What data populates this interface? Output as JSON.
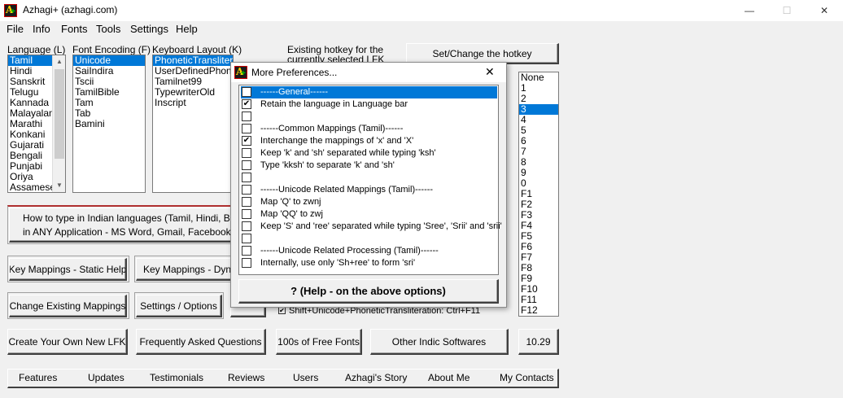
{
  "window": {
    "title": "Azhagi+ (azhagi.com)",
    "min": "—",
    "max": "☐",
    "close": "✕"
  },
  "menu": [
    "File",
    "Info",
    "Fonts",
    "Tools",
    "Settings",
    "Help"
  ],
  "labels": {
    "language": "Language (L)",
    "font_encoding": "Font Encoding (F)",
    "keyboard_layout": "Keyboard Layout (K)",
    "hotkey_info_1": "Existing hotkey for the",
    "hotkey_info_2": "currently selected LFK"
  },
  "languages": [
    "Tamil",
    "Hindi",
    "Sanskrit",
    "Telugu",
    "Kannada",
    "Malayalam",
    "Marathi",
    "Konkani",
    "Gujarati",
    "Bengali",
    "Punjabi",
    "Oriya",
    "Assamese"
  ],
  "encodings": [
    "Unicode",
    "SaiIndira",
    "Tscii",
    "TamilBible",
    "Tam",
    "Tab",
    "Bamini"
  ],
  "layouts": [
    "PhoneticTransliteration",
    "UserDefinedPhonetic",
    "Tamilnet99",
    "TypewriterOld",
    "Inscript"
  ],
  "hotkeys": [
    "None",
    "1",
    "2",
    "3",
    "4",
    "5",
    "6",
    "7",
    "8",
    "9",
    "0",
    "F1",
    "F2",
    "F3",
    "F4",
    "F5",
    "F6",
    "F7",
    "F8",
    "F9",
    "F10",
    "F11",
    "F12"
  ],
  "buttons": {
    "set_hotkey": "Set/Change the hotkey",
    "howto_1": "How to type in Indian languages (Tamil, Hindi, Bengali",
    "howto_2": "in ANY Application - MS Word, Gmail, Facebook, Blog",
    "key_static": "Key Mappings - Static Help",
    "key_dynamic": "Key Mappings - Dynam",
    "change_mappings": "Change Existing Mappings",
    "settings_options": "Settings / Options",
    "create_lfk": "Create Your Own New LFK",
    "faq": "Frequently Asked Questions",
    "free_fonts": "100s of Free Fonts",
    "other_indic": "Other Indic Softwares",
    "version": "10.29"
  },
  "hidden_strip": "Shift+Unicode+PhoneticTransliteration: Ctrl+F11",
  "dialog": {
    "title": "More Preferences...",
    "close": "✕",
    "help_button": "?  (Help - on the above options)",
    "options": [
      {
        "label": "------General------",
        "checked": false
      },
      {
        "label": "Retain the language in Language bar",
        "checked": true
      },
      {
        "label": "",
        "checked": false
      },
      {
        "label": "------Common Mappings (Tamil)------",
        "checked": false
      },
      {
        "label": "Interchange the mappings of 'x' and 'X'",
        "checked": true
      },
      {
        "label": "Keep 'k' and 'sh' separated while typing 'ksh'",
        "checked": false
      },
      {
        "label": "Type 'kksh' to separate 'k' and 'sh'",
        "checked": false
      },
      {
        "label": "",
        "checked": false
      },
      {
        "label": "------Unicode Related Mappings (Tamil)------",
        "checked": false
      },
      {
        "label": "Map 'Q' to zwnj",
        "checked": false
      },
      {
        "label": "Map 'QQ' to zwj",
        "checked": false
      },
      {
        "label": "Keep 'S' and 'ree' separated while typing 'Sree', 'Srii' and 'srii'",
        "checked": false
      },
      {
        "label": "",
        "checked": false
      },
      {
        "label": "------Unicode Related Processing (Tamil)------",
        "checked": false
      },
      {
        "label": "Internally, use only 'Sh+ree' to form 'sri'",
        "checked": false
      }
    ]
  },
  "nav": [
    "Features",
    "Updates",
    "Testimonials",
    "Reviews",
    "Users",
    "Azhagi's Story",
    "About Me",
    "My Contacts"
  ],
  "colors": {
    "selection": "#0078d7",
    "window_bg": "#f0f0f0"
  }
}
